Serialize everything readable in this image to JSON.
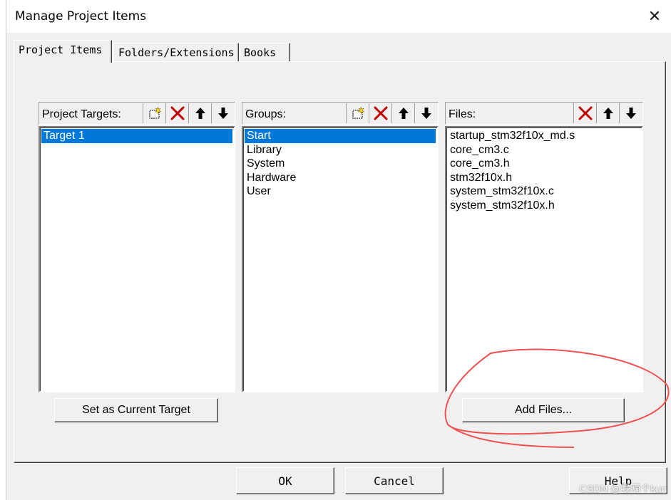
{
  "dialog": {
    "title": "Manage Project Items",
    "close_glyph": "✕"
  },
  "tabs": [
    {
      "label": "Project Items",
      "active": true
    },
    {
      "label": "Folders/Extensions",
      "active": false
    },
    {
      "label": "Books",
      "active": false
    }
  ],
  "targets": {
    "label": "Project Targets:",
    "items": [
      "Target 1"
    ],
    "selected": 0
  },
  "groups": {
    "label": "Groups:",
    "items": [
      "Start",
      "Library",
      "System",
      "Hardware",
      "User"
    ],
    "selected": 0
  },
  "files": {
    "label": "Files:",
    "items": [
      "startup_stm32f10x_md.s",
      "core_cm3.c",
      "core_cm3.h",
      "stm32f10x.h",
      "system_stm32f10x.c",
      "system_stm32f10x.h"
    ]
  },
  "buttons": {
    "set_current": "Set as Current Target",
    "add_files": "Add Files...",
    "ok": "OK",
    "cancel": "Cancel",
    "help": "Help"
  },
  "icons": {
    "new": "new-item-icon",
    "delete": "delete-icon",
    "up": "move-up-icon",
    "down": "move-down-icon"
  },
  "colors": {
    "selection": "#0078d7",
    "delete_x": "#c00000",
    "annotation_circle": "#f05050"
  },
  "watermark": "CSDN @我嗬个kun"
}
